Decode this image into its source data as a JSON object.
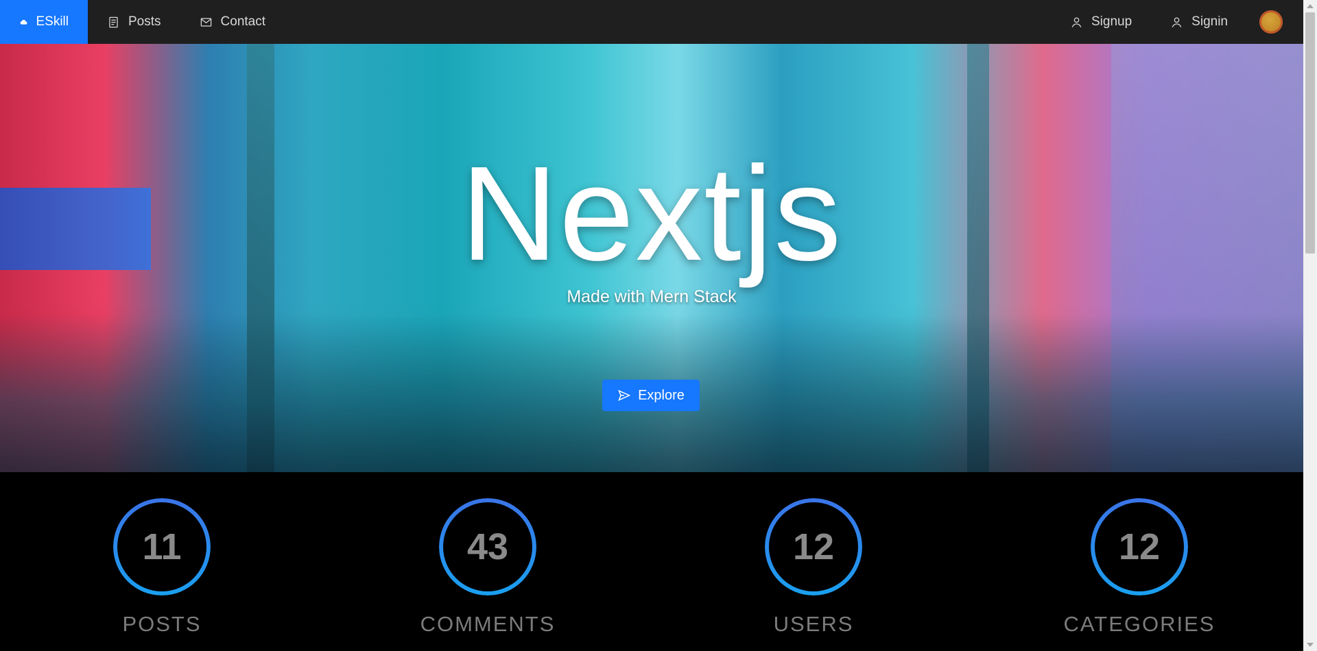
{
  "nav": {
    "brand": "ESkill",
    "items": [
      {
        "label": "Posts",
        "icon": "document-icon"
      },
      {
        "label": "Contact",
        "icon": "mail-icon"
      }
    ],
    "right": [
      {
        "label": "Signup",
        "icon": "user-icon"
      },
      {
        "label": "Signin",
        "icon": "user-icon"
      }
    ],
    "colors": {
      "bar": "#1f1f1f",
      "active": "#1677ff"
    }
  },
  "hero": {
    "title": "Nextjs",
    "subtitle": "Made with Mern Stack",
    "button_label": "Explore",
    "image_alt": "Neon city street scene"
  },
  "stats": [
    {
      "value": "11",
      "label": "POSTS"
    },
    {
      "value": "43",
      "label": "COMMENTS"
    },
    {
      "value": "12",
      "label": "USERS"
    },
    {
      "value": "12",
      "label": "CATEGORIES"
    }
  ],
  "accent_color": "#1677ff"
}
